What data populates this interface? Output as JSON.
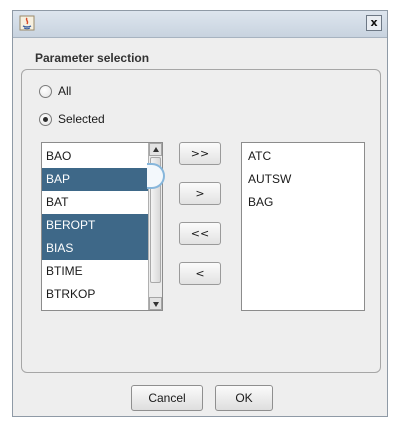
{
  "window": {
    "close_glyph": "x"
  },
  "group": {
    "title": "Parameter selection"
  },
  "radios": {
    "all_label": "All",
    "selected_label": "Selected",
    "checked": "Selected"
  },
  "available_list": {
    "items": [
      {
        "label": "BAO",
        "selected": false
      },
      {
        "label": "BAP",
        "selected": true
      },
      {
        "label": "BAT",
        "selected": false
      },
      {
        "label": "BEROPT",
        "selected": true
      },
      {
        "label": "BIAS",
        "selected": true
      },
      {
        "label": "BTIME",
        "selected": false
      },
      {
        "label": "BTRKOP",
        "selected": false
      }
    ]
  },
  "move_buttons": {
    "add_all": ">>",
    "add": ">",
    "remove_all": "<<",
    "remove": "<"
  },
  "chosen_list": {
    "items": [
      "ATC",
      "AUTSW",
      "BAG"
    ]
  },
  "buttons": {
    "cancel": "Cancel",
    "ok": "OK"
  },
  "colors": {
    "selection": "#3e6888",
    "titlebar": "#c8d3df"
  }
}
